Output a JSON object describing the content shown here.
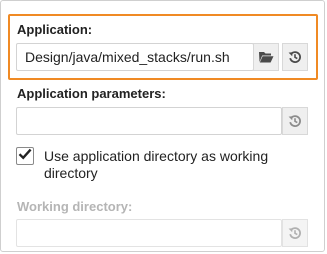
{
  "application": {
    "label": "Application:",
    "value": "Design/java/mixed_stacks/run.sh",
    "browse_icon": "folder-open-icon",
    "reset_icon": "history-reset-icon"
  },
  "parameters": {
    "label": "Application parameters:",
    "value": "",
    "reset_icon": "history-reset-icon"
  },
  "use_app_dir": {
    "checked": true,
    "label": "Use application directory as working directory"
  },
  "working_directory": {
    "label": "Working directory:",
    "value": "",
    "disabled": true,
    "reset_icon": "history-reset-icon"
  },
  "colors": {
    "focus_border": "#f08a24",
    "disabled_text": "#b5b5b5",
    "icon": "#4a4a4a",
    "icon_disabled": "#b0b0b0"
  }
}
